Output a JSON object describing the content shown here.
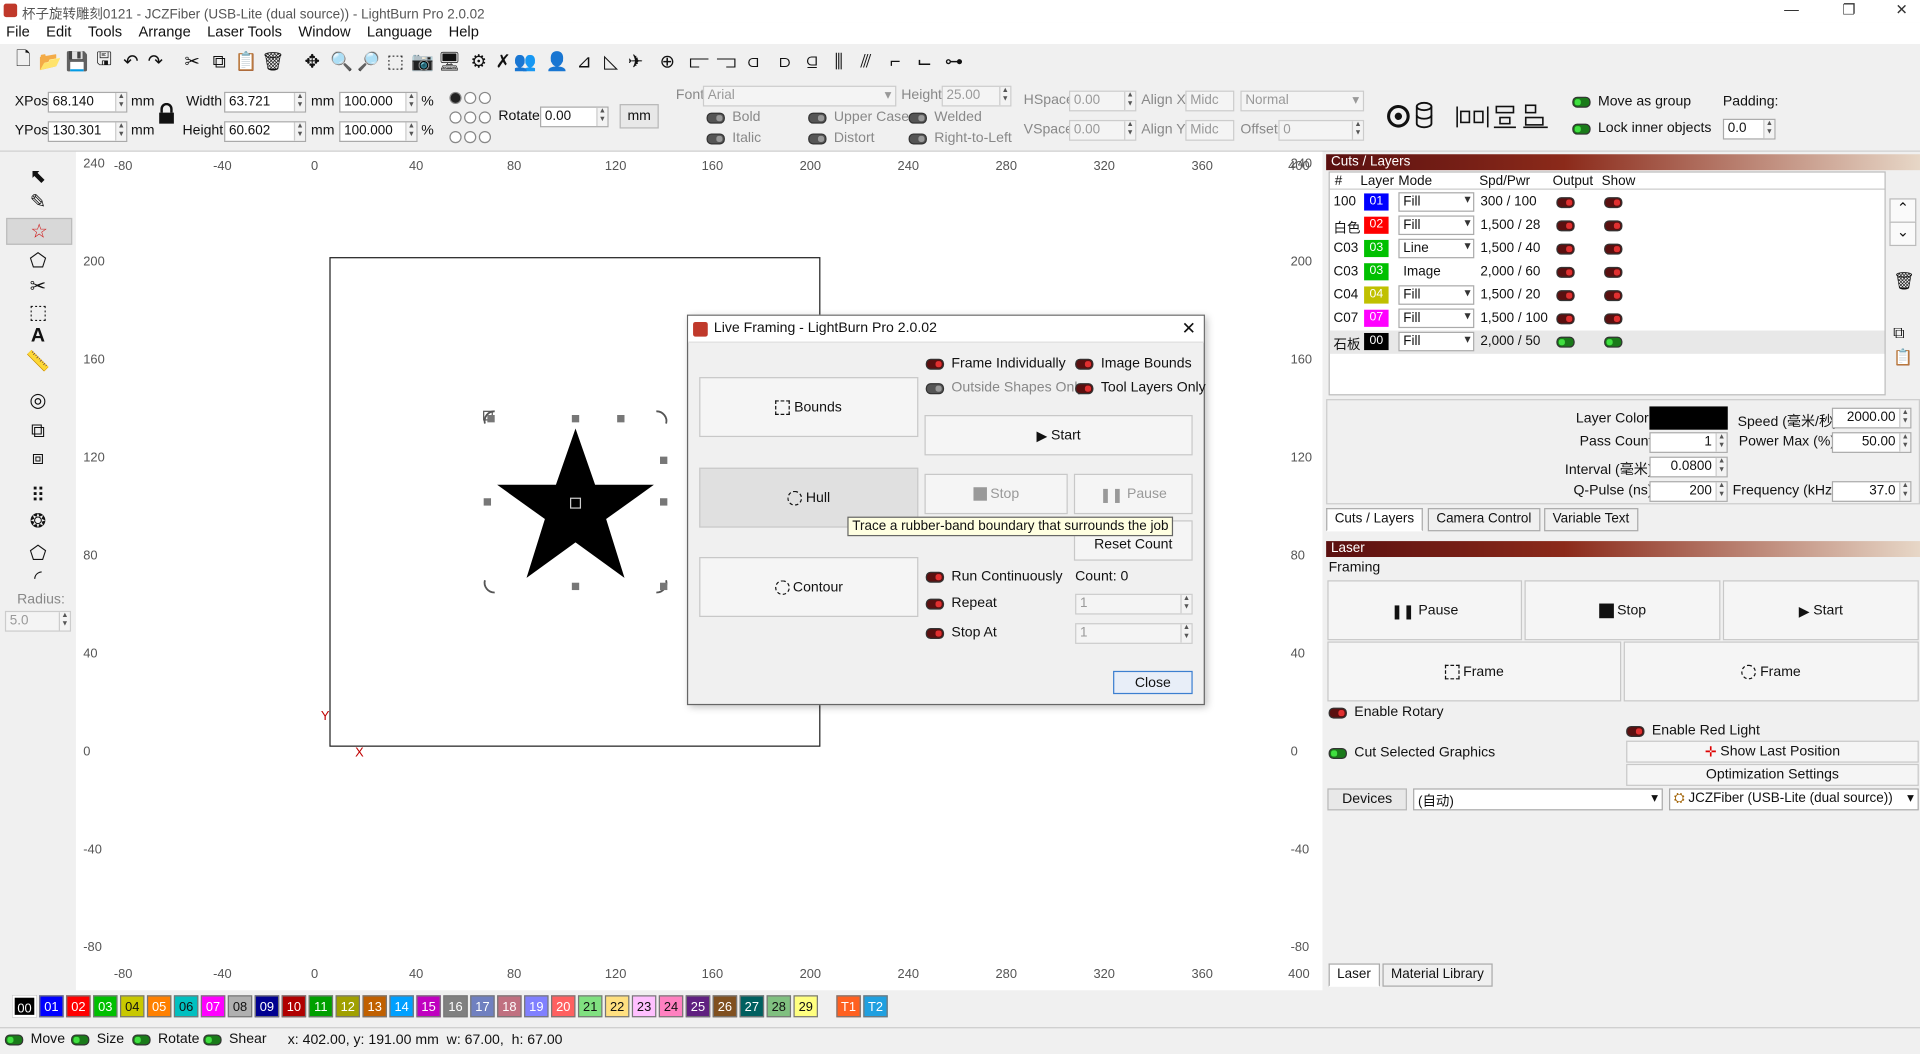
{
  "window": {
    "title": "杯子旋转雕刻0121 - JCZFiber (USB-Lite (dual source)) - LightBurn Pro 2.0.02",
    "minimize": "—",
    "maximize": "❐",
    "close": "✕"
  },
  "menu": [
    "File",
    "Edit",
    "Tools",
    "Arrange",
    "Laser Tools",
    "Window",
    "Language",
    "Help"
  ],
  "toolbar_icons": [
    "new-file-icon",
    "open-file-icon",
    "save-icon",
    "save-as-icon",
    "undo-icon",
    "redo-icon",
    "cut-icon",
    "copy-icon",
    "paste-icon",
    "delete-icon",
    "move-icon",
    "zoom-in-icon",
    "zoom-out-icon",
    "zoom-frame-icon",
    "camera-icon",
    "monitor-icon",
    "settings-icon",
    "tools-icon",
    "group-icon",
    "ungroup-icon",
    "mirror-h-icon",
    "mirror-v-icon",
    "rotate-icon",
    "align-left-icon",
    "align-center-icon",
    "align-right-icon",
    "align-top-icon",
    "align-middle-icon",
    "align-bottom-icon",
    "distribute-h-icon",
    "distribute-v-icon",
    "dock-icon",
    "arrange-icon",
    "spacing-icon"
  ],
  "numeric": {
    "xpos_label": "XPos",
    "xpos": "68.140",
    "ypos_label": "YPos",
    "ypos": "130.301",
    "unit": "mm",
    "width_label": "Width",
    "width": "63.721",
    "height_label": "Height",
    "height": "60.602",
    "scale_w": "100.000",
    "scale_h": "100.000",
    "pct": "%",
    "rotate_label": "Rotate",
    "rotate": "0.00",
    "units_btn": "mm"
  },
  "text_opts": {
    "font_label": "Font",
    "font": "Arial",
    "height_label": "Height",
    "height": "25.00",
    "hspace_label": "HSpace",
    "hspace": "0.00",
    "vspace_label": "VSpace",
    "vspace": "0.00",
    "alignx_label": "Align X",
    "alignx": "Midc",
    "aligny_label": "Align Y",
    "aligny": "Midc",
    "normal": "Normal",
    "offset_label": "Offset",
    "offset": "0",
    "bold": "Bold",
    "italic": "Italic",
    "upper": "Upper Case",
    "distort": "Distort",
    "welded": "Welded",
    "rtl": "Right-to-Left"
  },
  "group_opts": {
    "move_group": "Move as group",
    "lock_inner": "Lock inner objects",
    "padding_label": "Padding:",
    "padding": "0.0"
  },
  "left_tools": {
    "radius_label": "Radius:",
    "radius": "5.0"
  },
  "ruler": {
    "x": [
      "-80",
      "-40",
      "0",
      "40",
      "80",
      "120",
      "160",
      "200",
      "240",
      "280",
      "320",
      "360",
      "400"
    ],
    "y": [
      "240",
      "200",
      "160",
      "120",
      "80",
      "40",
      "0",
      "-40",
      "-80"
    ],
    "origin_y": "Y",
    "origin_x": "X"
  },
  "dialog": {
    "title": "Live Framing - LightBurn Pro 2.0.02",
    "frame_individually": "Frame Individually",
    "image_bounds": "Image Bounds",
    "outside_shapes": "Outside Shapes Only",
    "tool_layers": "Tool Layers Only",
    "bounds": "Bounds",
    "hull": "Hull",
    "contour": "Contour",
    "start": "Start",
    "stop": "Stop",
    "pause": "Pause",
    "reset": "Reset Count",
    "tooltip": "Trace a rubber-band boundary that surrounds the job",
    "run_cont": "Run Continuously",
    "count": "Count: 0",
    "repeat": "Repeat",
    "repeat_val": "1",
    "stop_at": "Stop At",
    "stop_at_val": "1",
    "close": "Close"
  },
  "cuts": {
    "header": "Cuts / Layers",
    "cols": [
      "#",
      "Layer",
      "Mode",
      "Spd/Pwr",
      "Output",
      "Show"
    ],
    "rows": [
      {
        "num": "100",
        "layer": "01",
        "color": "#0000ff",
        "mode": "Fill",
        "spd": "300 / 100",
        "out": false,
        "show": false
      },
      {
        "num": "白色",
        "layer": "02",
        "color": "#ff0000",
        "mode": "Fill",
        "spd": "1,500 / 28",
        "out": false,
        "show": false
      },
      {
        "num": "C03",
        "layer": "03",
        "color": "#00c000",
        "mode": "Line",
        "spd": "1,500 / 40",
        "out": false,
        "show": false
      },
      {
        "num": "C03",
        "layer": "03",
        "color": "#00c000",
        "mode": "Image",
        "spd": "2,000 / 60",
        "out": false,
        "show": false
      },
      {
        "num": "C04",
        "layer": "04",
        "color": "#c0c000",
        "mode": "Fill",
        "spd": "1,500 / 20",
        "out": false,
        "show": false
      },
      {
        "num": "C07",
        "layer": "07",
        "color": "#ff00ff",
        "mode": "Fill",
        "spd": "1,500 / 100",
        "out": false,
        "show": false
      },
      {
        "num": "石板",
        "layer": "00",
        "color": "#000000",
        "mode": "Fill",
        "spd": "2,000 / 50",
        "out": true,
        "show": true
      }
    ],
    "layer_color_label": "Layer Color",
    "speed_label": "Speed (毫米/秒)",
    "speed": "2000.00",
    "pass_label": "Pass Count",
    "pass": "1",
    "power_label": "Power Max (%)",
    "power": "50.00",
    "interval_label": "Interval (毫米)",
    "interval": "0.0800",
    "qpulse_label": "Q-Pulse (ns)",
    "qpulse": "200",
    "freq_label": "Frequency (kHz)",
    "freq": "37.0",
    "tabs": [
      "Cuts / Layers",
      "Camera Control",
      "Variable Text"
    ]
  },
  "laser": {
    "header": "Laser",
    "framing": "Framing",
    "pause": "Pause",
    "stop": "Stop",
    "start": "Start",
    "frame1": "Frame",
    "frame2": "Frame",
    "rotary": "Enable Rotary",
    "red_light": "Enable Red Light",
    "cut_selected": "Cut Selected Graphics",
    "show_last": "Show Last Position",
    "optim": "Optimization Settings",
    "devices": "Devices",
    "port": "(自动)",
    "device": "JCZFiber (USB-Lite (dual source))",
    "tabs": [
      "Laser",
      "Material Library"
    ]
  },
  "palette": [
    {
      "l": "00",
      "c": "#000000"
    },
    {
      "l": "01",
      "c": "#0000ff"
    },
    {
      "l": "02",
      "c": "#ff0000"
    },
    {
      "l": "03",
      "c": "#00c000"
    },
    {
      "l": "04",
      "c": "#c8c800"
    },
    {
      "l": "05",
      "c": "#ff8000"
    },
    {
      "l": "06",
      "c": "#00c0c0"
    },
    {
      "l": "07",
      "c": "#ff00ff"
    },
    {
      "l": "08",
      "c": "#b0b0b0"
    },
    {
      "l": "09",
      "c": "#000090"
    },
    {
      "l": "10",
      "c": "#b00000"
    },
    {
      "l": "11",
      "c": "#00a000"
    },
    {
      "l": "12",
      "c": "#a0a000"
    },
    {
      "l": "13",
      "c": "#c06000"
    },
    {
      "l": "14",
      "c": "#00a0ff"
    },
    {
      "l": "15",
      "c": "#c000c0"
    },
    {
      "l": "16",
      "c": "#808080"
    },
    {
      "l": "17",
      "c": "#7080c0"
    },
    {
      "l": "18",
      "c": "#c07080"
    },
    {
      "l": "19",
      "c": "#8080ff"
    },
    {
      "l": "20",
      "c": "#ff6060"
    },
    {
      "l": "21",
      "c": "#80e080"
    },
    {
      "l": "22",
      "c": "#ffe080"
    },
    {
      "l": "23",
      "c": "#ffc0ff"
    },
    {
      "l": "24",
      "c": "#ff80c0"
    },
    {
      "l": "25",
      "c": "#602080"
    },
    {
      "l": "26",
      "c": "#805020"
    },
    {
      "l": "27",
      "c": "#006060"
    },
    {
      "l": "28",
      "c": "#80c080"
    },
    {
      "l": "29",
      "c": "#ffff80"
    },
    {
      "l": "T1",
      "c": "#ff6020"
    },
    {
      "l": "T2",
      "c": "#20a0e0"
    }
  ],
  "status": {
    "move": "Move",
    "size": "Size",
    "rotate": "Rotate",
    "shear": "Shear",
    "coords": "x: 402.00, y: 191.00 mm  w: 67.00,  h: 67.00"
  }
}
